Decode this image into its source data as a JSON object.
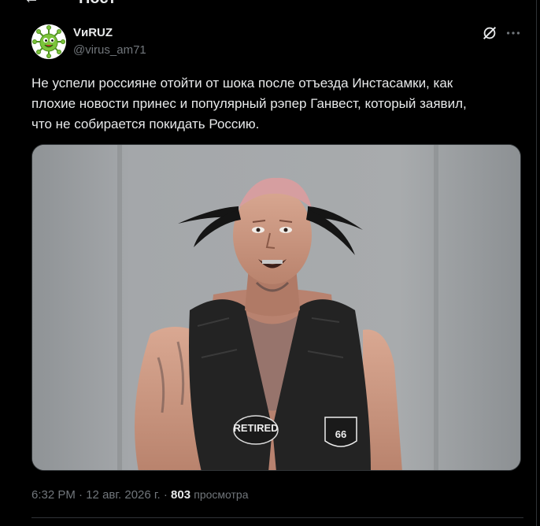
{
  "header": {
    "back_icon": "arrow-left-icon",
    "title": "Пост"
  },
  "author": {
    "display_name": "VиRUZ",
    "handle": "@virus_am71",
    "avatar_icon": "green-virus-avatar"
  },
  "actions": {
    "grok_icon": "grok-icon",
    "more_icon": "more-horizontal-icon"
  },
  "post": {
    "text": "Не успели россияне отойти от шока после отъезда Инстасамки, как\nплохие новости принес и популярный рэпер Ганвест, который заявил,\nчто не собирается покидать Россию."
  },
  "media": {
    "type": "photo",
    "vest_patch_left": "RETIRED",
    "vest_patch_right": "66"
  },
  "meta": {
    "time": "6:32 PM",
    "separator": "·",
    "date": "12 авг. 2026 г.",
    "views_count": "803",
    "views_label": "просмотра"
  },
  "colors": {
    "background": "#000000",
    "text_primary": "#e7e9ea",
    "text_secondary": "#71767b",
    "border": "#2f3336"
  }
}
